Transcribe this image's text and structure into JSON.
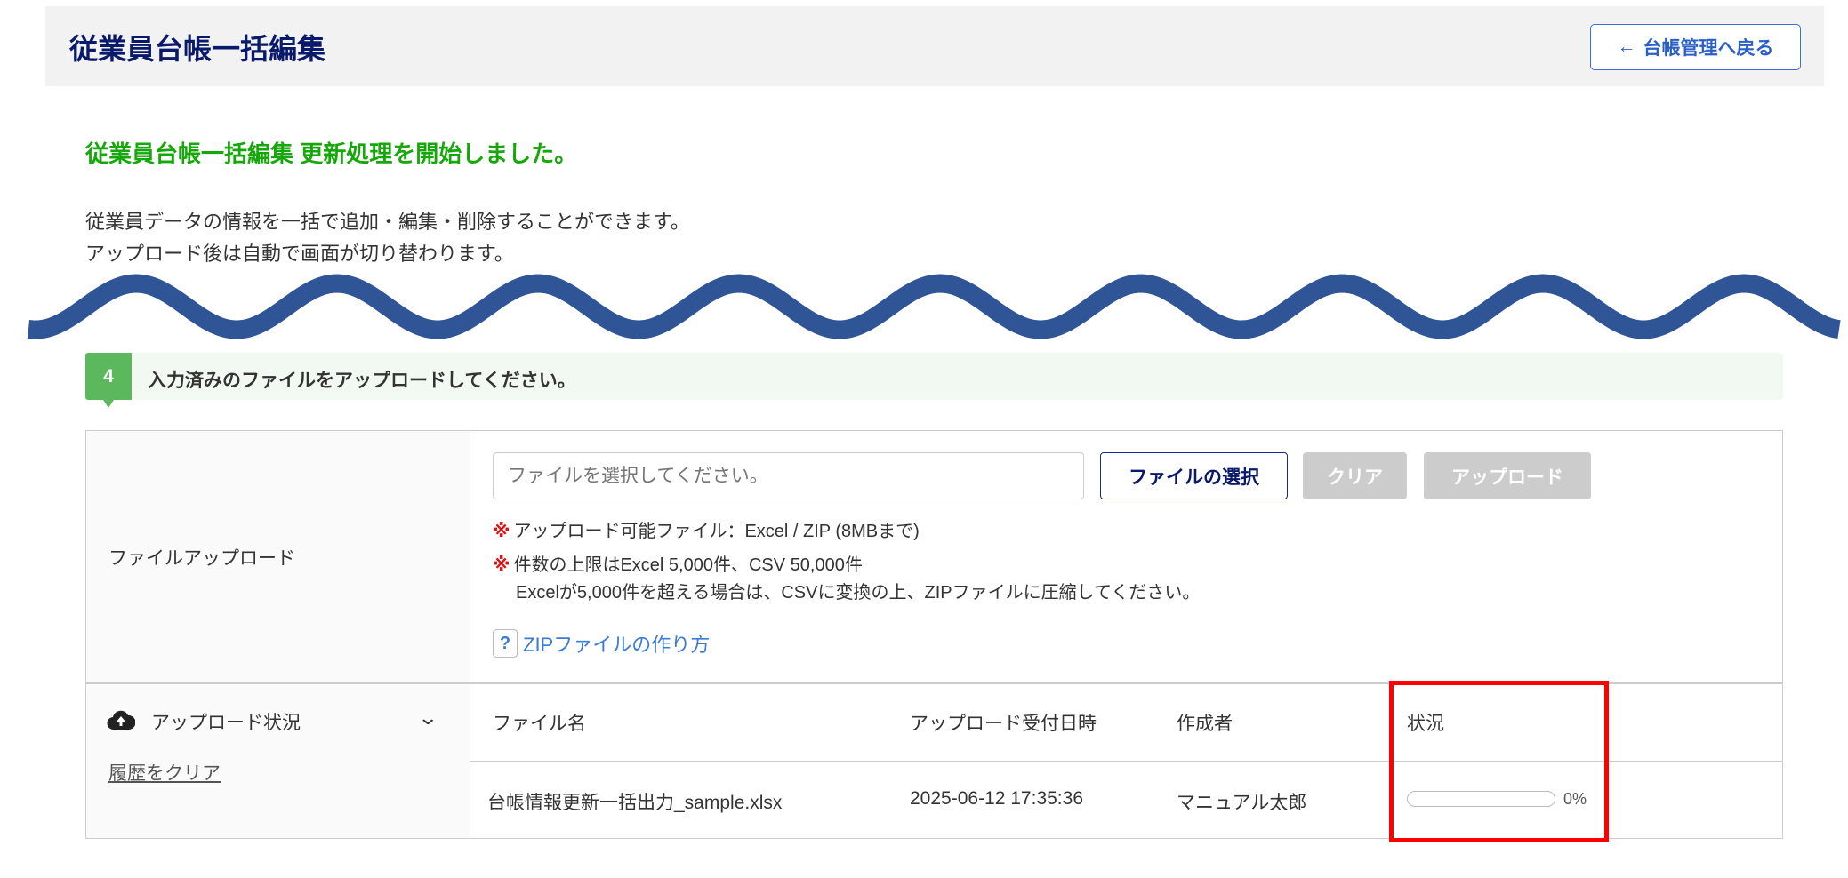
{
  "header": {
    "title": "従業員台帳一括編集",
    "back_label": "台帳管理へ戻る",
    "back_icon": "arrow-left-icon"
  },
  "message": {
    "success": "従業員台帳一括編集 更新処理を開始しました。",
    "desc1": "従業員データの情報を一括で追加・編集・削除することができます。",
    "desc2": "アップロード後は自動で画面が切り替わります。"
  },
  "step": {
    "number": "4",
    "text": "入力済みのファイルをアップロードしてください。"
  },
  "upload": {
    "label": "ファイルアップロード",
    "placeholder": "ファイルを選択してください。",
    "choose_label": "ファイルの選択",
    "clear_label": "クリア",
    "upload_label": "アップロード",
    "mark": "※",
    "note1": "アップロード可能ファイル：Excel / ZIP (8MBまで)",
    "note2": "件数の上限はExcel 5,000件、CSV 50,000件",
    "note3": "Excelが5,000件を超える場合は、CSVに変換の上、ZIPファイルに圧縮してください。",
    "help_icon": "?",
    "zip_link": "ZIPファイルの作り方"
  },
  "status": {
    "label": "アップロード状況",
    "clear_history": "履歴をクリア",
    "columns": [
      "ファイル名",
      "アップロード受付日時",
      "作成者",
      "状況"
    ],
    "rows": [
      {
        "file": "台帳情報更新一括出力_sample.xlsx",
        "datetime": "2025-06-12 17:35:36",
        "author": "マニュアル太郎",
        "progress": 0,
        "progress_text": "0%"
      }
    ]
  },
  "colors": {
    "wave": "#2f5597",
    "highlight": "#ff0000",
    "accent_green": "#16a80a"
  }
}
